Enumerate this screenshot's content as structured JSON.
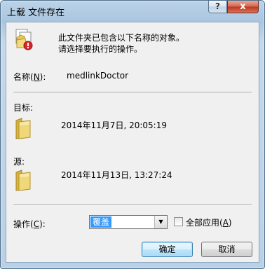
{
  "window": {
    "title": "上载 文件存在",
    "help_label": "?",
    "close_label": "x"
  },
  "message": {
    "line1": "此文件夹已包含以下名称的对象。",
    "line2": "请选择要执行的操作。"
  },
  "name_field": {
    "label_prefix": "名称(",
    "label_key": "N",
    "label_suffix": "):",
    "value": "medlinkDoctor"
  },
  "target": {
    "label": "目标:",
    "date": "2014年11月7日, 20:05:19"
  },
  "source": {
    "label": "源:",
    "date": "2014年11月13日, 13:27:24"
  },
  "operation": {
    "label_prefix": "操作(",
    "label_key": "C",
    "label_suffix": "):",
    "selected": "覆盖",
    "apply_all_prefix": "全部应用(",
    "apply_all_key": "A",
    "apply_all_suffix": ")",
    "apply_all_checked": false
  },
  "buttons": {
    "ok": "确定",
    "cancel": "取消"
  },
  "icons": {
    "dialog": "file-warning-icon",
    "target": "folder-icon",
    "source": "folder-icon",
    "combo_arrow": "chevron-down-icon"
  },
  "colors": {
    "folder": "#e8c85a",
    "warning": "#d9262b",
    "selection": "#3399ff"
  }
}
